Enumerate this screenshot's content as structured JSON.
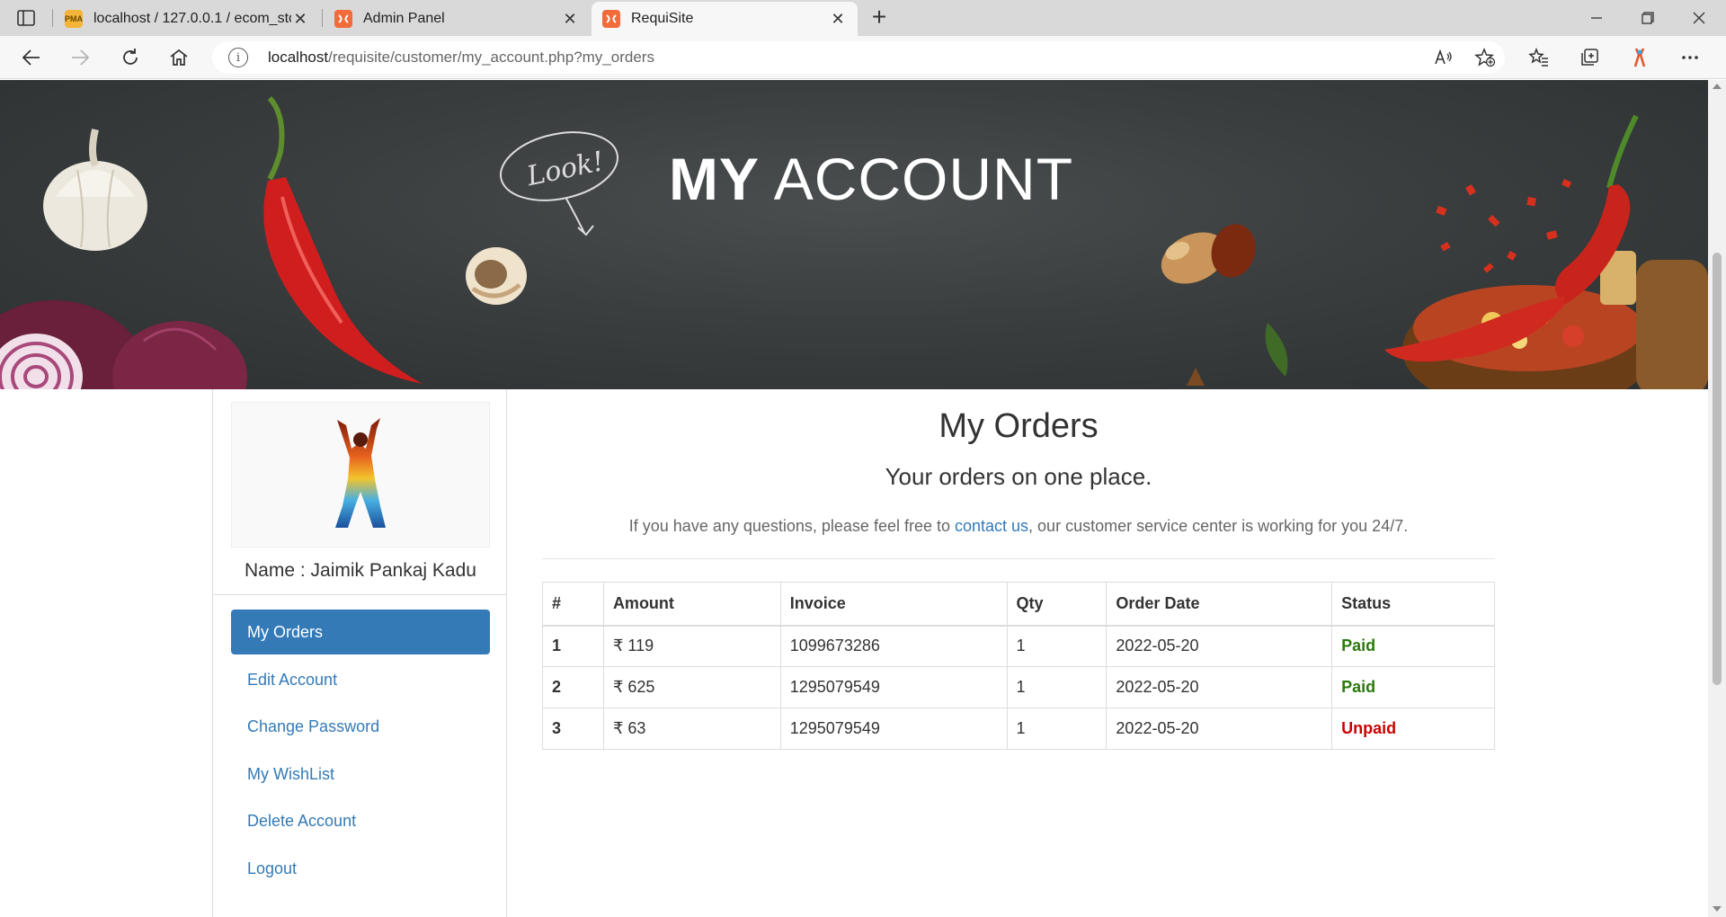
{
  "browser": {
    "tabs": [
      {
        "title": "localhost / 127.0.0.1 / ecom_stor",
        "favicon": "pma-icon",
        "active": false
      },
      {
        "title": "Admin Panel",
        "favicon": "xampp-icon",
        "active": false
      },
      {
        "title": "RequiSite",
        "favicon": "xampp-icon",
        "active": true
      }
    ],
    "url_host": "localhost",
    "url_path": "/requisite/customer/my_account.php?my_orders"
  },
  "banner": {
    "title_bold": "MY",
    "title_rest": "ACCOUNT",
    "doodle_text": "Look!"
  },
  "sidebar": {
    "user_name": "Name : Jaimik Pankaj Kadu",
    "items": [
      {
        "label": "My Orders",
        "active": true
      },
      {
        "label": "Edit Account",
        "active": false
      },
      {
        "label": "Change Password",
        "active": false
      },
      {
        "label": "My WishList",
        "active": false
      },
      {
        "label": "Delete Account",
        "active": false
      },
      {
        "label": "Logout",
        "active": false
      }
    ]
  },
  "main": {
    "heading": "My Orders",
    "subheading": "Your orders on one place.",
    "lead_before": "If you have any questions, please feel free to ",
    "lead_link": "contact us",
    "lead_after": ", our customer service center is working for you 24/7.",
    "table": {
      "headers": [
        "#",
        "Amount",
        "Invoice",
        "Qty",
        "Order Date",
        "Status"
      ],
      "rows": [
        [
          "1",
          "₹ 119",
          "1099673286",
          "1",
          "2022-05-20",
          "Paid"
        ],
        [
          "2",
          "₹ 625",
          "1295079549",
          "1",
          "2022-05-20",
          "Paid"
        ],
        [
          "3",
          "₹ 63",
          "1295079549",
          "1",
          "2022-05-20",
          "Unpaid"
        ]
      ]
    }
  },
  "colors": {
    "link": "#337ab7",
    "paid": "#2b7a0b",
    "unpaid": "#cc0000"
  }
}
